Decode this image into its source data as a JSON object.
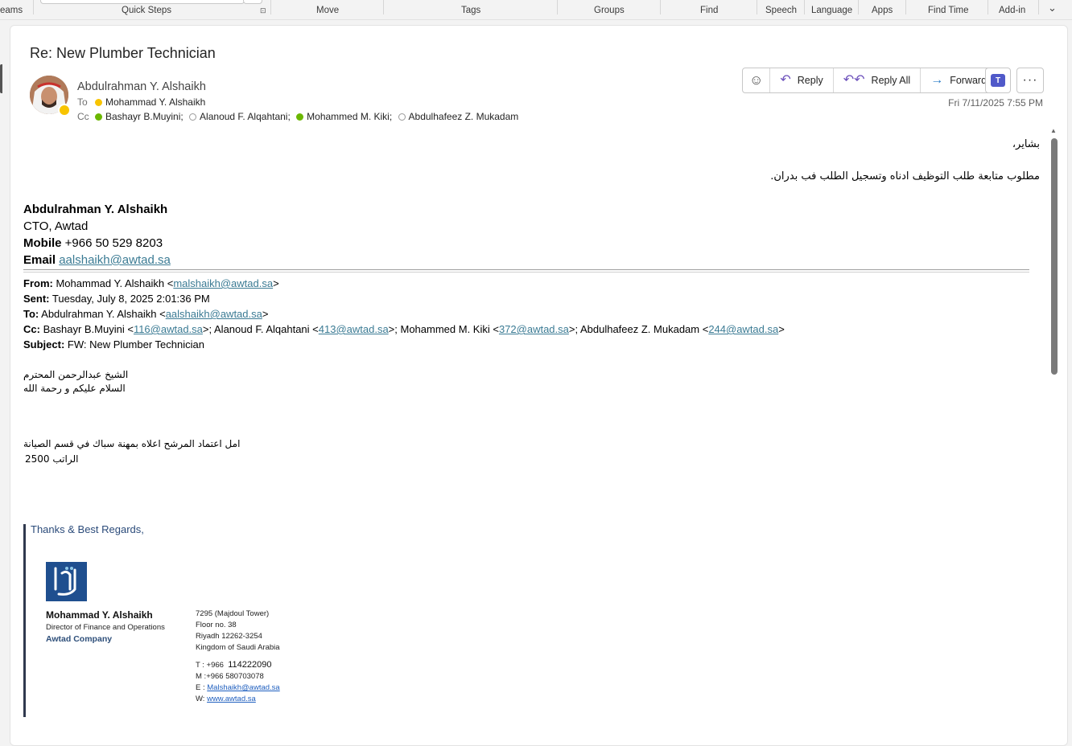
{
  "ribbon": {
    "groups": [
      "eams",
      "Quick Steps",
      "Move",
      "Tags",
      "Groups",
      "Find",
      "Speech",
      "Language",
      "Apps",
      "Find Time",
      "Add-in"
    ]
  },
  "message": {
    "subject": "Re: New Plumber Technician",
    "sender": "Abdulrahman Y. Alshaikh",
    "to_label": "To",
    "cc_label": "Cc",
    "to": [
      {
        "name": "Mohammad Y. Alshaikh",
        "status": "away"
      }
    ],
    "cc": [
      {
        "name": "Bashayr B.Muyini;",
        "status": "available"
      },
      {
        "name": "Alanoud F. Alqahtani;",
        "status": "offline"
      },
      {
        "name": "Mohammed M. Kiki;",
        "status": "available"
      },
      {
        "name": "Abdulhafeez Z. Mukadam",
        "status": "offline"
      }
    ],
    "date": "Fri 7/11/2025 7:55 PM"
  },
  "actions": {
    "reply": "Reply",
    "reply_all": "Reply All",
    "forward": "Forward"
  },
  "body": {
    "greeting": "بشاير،",
    "line1": "مطلوب متابعة طلب التوظيف ادناه وتسجيل الطلب فب بدران."
  },
  "signature": {
    "name": "Abdulrahman Y. Alshaikh",
    "title": "CTO, Awtad",
    "mobile_label": "Mobile",
    "mobile": "+966 50 529 8203",
    "email_label": "Email",
    "email": "aalshaikh@awtad.sa"
  },
  "forwarded": {
    "from_label": "From:",
    "from_name": "Mohammad Y. Alshaikh <",
    "from_email": "malshaikh@awtad.sa",
    "sent_label": "Sent:",
    "sent": "Tuesday, July 8, 2025 2:01:36 PM",
    "to_label": "To:",
    "to_name": "Abdulrahman Y. Alshaikh <",
    "to_email": "aalshaikh@awtad.sa",
    "cc_label": "Cc:",
    "cc": [
      {
        "name": "Bashayr B.Muyini <",
        "email": "116@awtad.sa"
      },
      {
        "name": ">; Alanoud F. Alqahtani <",
        "email": "413@awtad.sa"
      },
      {
        "name": ">; Mohammed M. Kiki <",
        "email": "372@awtad.sa"
      },
      {
        "name": ">; Abdulhafeez Z. Mukadam <",
        "email": "244@awtad.sa"
      }
    ],
    "subject_label": "Subject:",
    "subject": "FW: New Plumber Technician",
    "ar_line1": "الشيخ عبدالرحمن            المحترم",
    "ar_line2": "السلام عليكم و رحمة الله",
    "ar_line3": "امل اعتماد المرشح اعلاه بمهنة سباك في قسم الصيانة",
    "ar_line4": "الراتب 2500",
    "regards": "Thanks & Best Regards,",
    "card": {
      "name": "Mohammad Y. Alshaikh",
      "role": "Director of Finance and Operations",
      "company": "Awtad Company",
      "addr1": "7295 (Majdoul Tower)",
      "addr2": "Floor no. 38",
      "addr3": "Riyadh 12262-3254",
      "addr4": "Kingdom of Saudi Arabia",
      "tel_prefix": "T : +966",
      "tel": "114222090",
      "mobile": "M :+966 580703078",
      "email_label": "E :",
      "email": "Malshaikh@awtad.sa",
      "web_label": "W:",
      "web": "www.awtad.sa"
    }
  },
  "colors": {
    "link": "#3b7b94",
    "reply_icon": "#6b4fbb",
    "forward_icon": "#2a7cc7",
    "teams": "#5059c9",
    "presence_away": "#f8c400",
    "presence_available": "#6bb700"
  }
}
